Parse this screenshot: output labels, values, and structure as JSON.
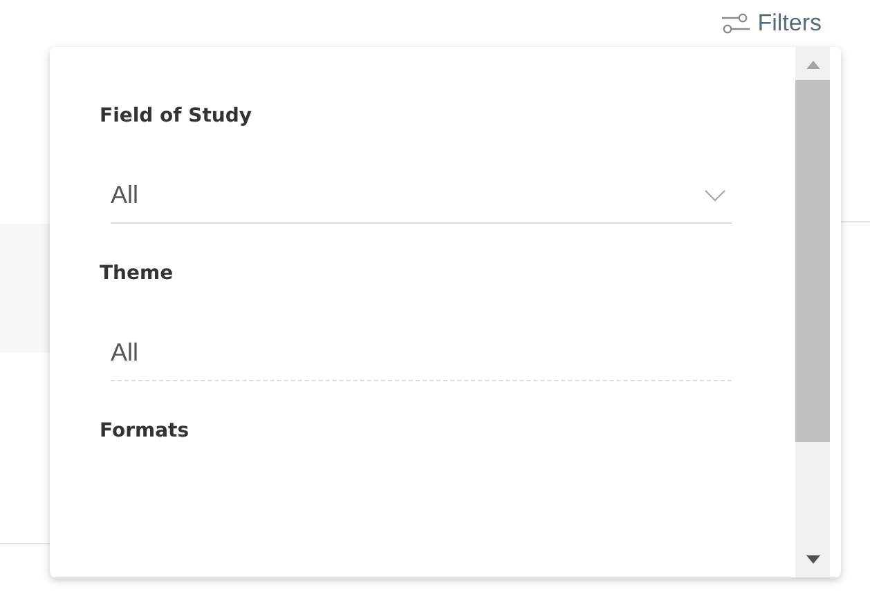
{
  "filters_button": {
    "label": "Filters"
  },
  "filters": [
    {
      "label": "Field of Study",
      "kind": "select",
      "value": "All"
    },
    {
      "label": "Theme",
      "kind": "text",
      "value": "All"
    },
    {
      "label": "Formats",
      "kind": "label"
    }
  ]
}
